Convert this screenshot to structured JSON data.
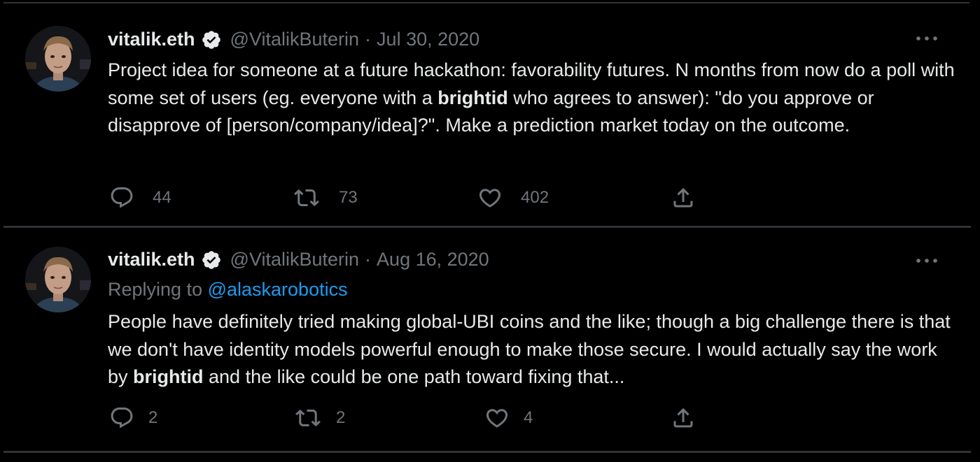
{
  "tweets": [
    {
      "name": "vitalik.eth",
      "handle": "@VitalikButerin",
      "separator": "·",
      "date": "Jul 30, 2020",
      "text_segments": [
        {
          "text": "Project idea for someone at a future hackathon: favorability futures. N months from now do a poll with some set of users (eg. everyone with a "
        },
        {
          "text": "brightid",
          "bold": true
        },
        {
          "text": " who agrees to answer): \"do you approve or disapprove of [person/company/idea]?\". Make a prediction market today on the outcome."
        }
      ],
      "replies": "44",
      "retweets": "73",
      "likes": "402"
    },
    {
      "name": "vitalik.eth",
      "handle": "@VitalikButerin",
      "separator": "·",
      "date": "Aug 16, 2020",
      "replying_label": "Replying to ",
      "replying_mention": "@alaskarobotics",
      "text_segments": [
        {
          "text": "People have definitely tried making global-UBI coins and the like; though a big challenge there is that we don't have identity models powerful enough to make those secure. I would actually say the work by "
        },
        {
          "text": "brightid",
          "bold": true
        },
        {
          "text": " and the like could be one path toward fixing that..."
        }
      ],
      "replies": "2",
      "retweets": "2",
      "likes": "4"
    }
  ],
  "icons": {
    "verified": "verified-badge-icon",
    "more": "more-options-icon",
    "reply": "reply-icon",
    "retweet": "retweet-icon",
    "like": "like-icon",
    "share": "share-icon"
  },
  "colors": {
    "background": "#000000",
    "text": "#e7e9ea",
    "muted": "#71767b",
    "link": "#1d9bf0",
    "divider": "#2f3336"
  }
}
